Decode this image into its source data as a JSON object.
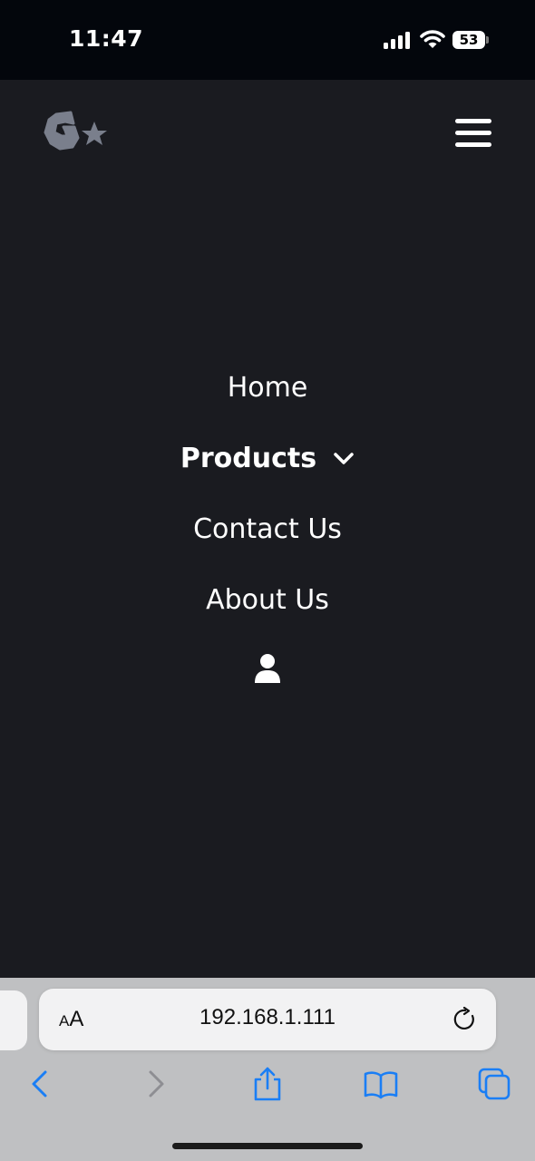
{
  "status_bar": {
    "time": "11:47",
    "battery_level": "53",
    "icons": [
      "signal-icon",
      "wifi-icon",
      "battery-icon"
    ]
  },
  "header": {
    "logo_icon": "gear-star-logo",
    "menu_icon": "hamburger-menu-icon"
  },
  "nav": {
    "items": [
      {
        "label": "Home"
      },
      {
        "label": "Products",
        "has_dropdown": true
      },
      {
        "label": "Contact Us"
      },
      {
        "label": "About Us"
      }
    ],
    "account_icon": "user-icon"
  },
  "browser": {
    "text_size_label_small": "A",
    "text_size_label_large": "A",
    "url": "192.168.1.111",
    "toolbar_icons": [
      "back-icon",
      "forward-icon",
      "share-icon",
      "bookmarks-icon",
      "tabs-icon"
    ]
  },
  "colors": {
    "background": "#1a1b20",
    "status_bar": "#03060c",
    "logo": "#7a7f8c",
    "browser_chrome": "#bfc0c2",
    "toolbar_accent": "#1a7ef5",
    "toolbar_disabled": "#8e8e93"
  }
}
